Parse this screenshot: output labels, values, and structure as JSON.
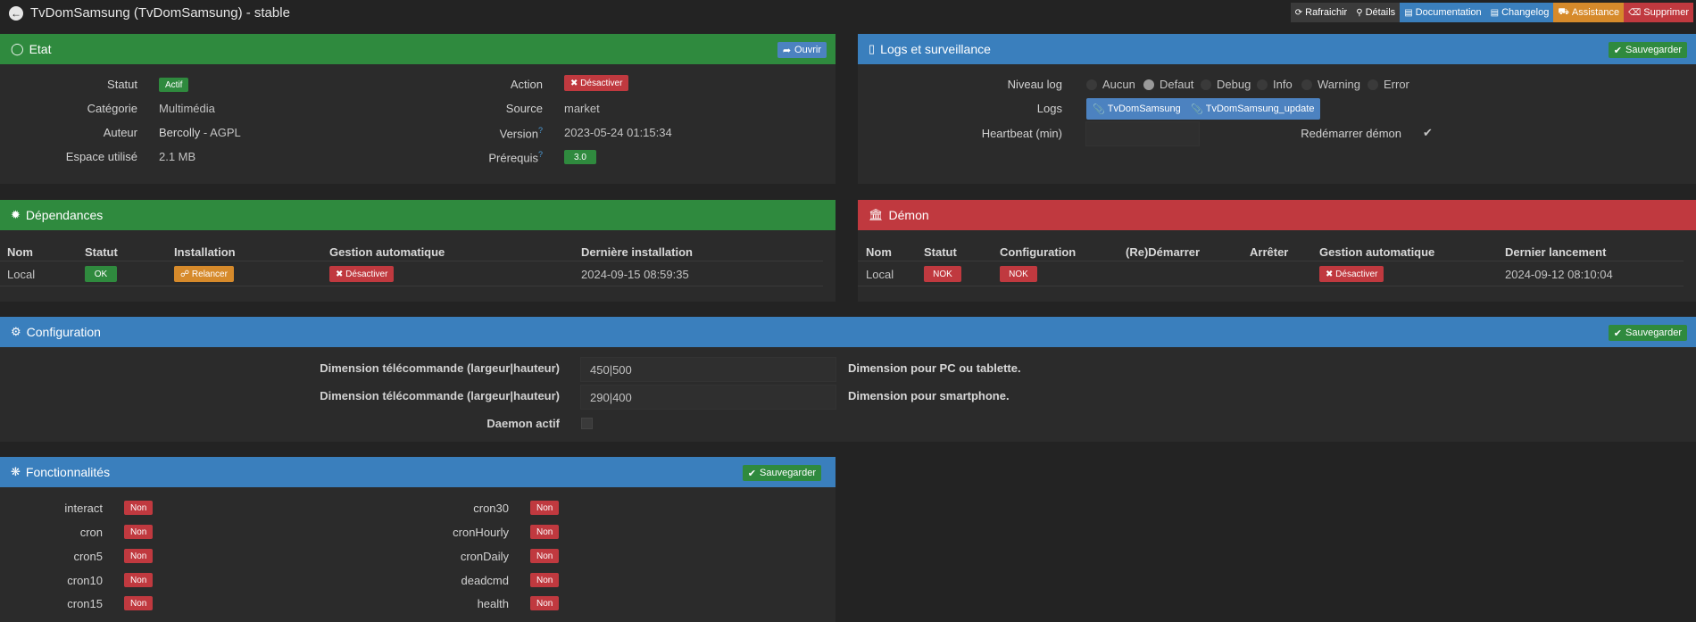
{
  "header": {
    "title": "TvDomSamsung (TvDomSamsung) - stable",
    "actions": [
      {
        "icon": "refresh-icon",
        "label": "Rafraichir",
        "color": "#3b3b3b"
      },
      {
        "icon": "search-icon",
        "label": "Détails",
        "color": "#3b3b3b"
      },
      {
        "icon": "book-icon",
        "label": "Documentation",
        "color": "#3a7fbd"
      },
      {
        "icon": "file-icon",
        "label": "Changelog",
        "color": "#3a7fbd"
      },
      {
        "icon": "ambulance-icon",
        "label": "Assistance",
        "color": "#d68a2b"
      },
      {
        "icon": "trash-icon",
        "label": "Supprimer",
        "color": "#c0393f"
      }
    ]
  },
  "etat": {
    "title": "Etat",
    "open_button": "Ouvrir",
    "statut_label": "Statut",
    "statut_value": "Actif",
    "categorie_label": "Catégorie",
    "categorie_value": "Multimédia",
    "auteur_label": "Auteur",
    "auteur_value": "Bercolly",
    "auteur_license": " - AGPL",
    "espace_label": "Espace utilisé",
    "espace_value": "2.1 MB",
    "action_label": "Action",
    "action_value": "Désactiver",
    "source_label": "Source",
    "source_value": "market",
    "version_label": "Version",
    "version_value": "2023-05-24 01:15:34",
    "prerequis_label": "Prérequis",
    "prerequis_value": "3.0"
  },
  "logs": {
    "title": "Logs et surveillance",
    "save_button": "Sauvegarder",
    "niveau_label": "Niveau log",
    "levels": [
      "Aucun",
      "Defaut",
      "Debug",
      "Info",
      "Warning",
      "Error"
    ],
    "selected_level": "Defaut",
    "logs_label": "Logs",
    "log_buttons": [
      "TvDomSamsung",
      "TvDomSamsung_update"
    ],
    "heartbeat_label": "Heartbeat (min)",
    "heartbeat_value": "",
    "restart_label": "Redémarrer démon",
    "restart_checked": true
  },
  "dependances": {
    "title": "Dépendances",
    "columns": [
      "Nom",
      "Statut",
      "Installation",
      "Gestion automatique",
      "Dernière installation"
    ],
    "row": {
      "nom": "Local",
      "statut": "OK",
      "installation": "Relancer",
      "gestion": "Désactiver",
      "derniere": "2024-09-15 08:59:35"
    }
  },
  "demon": {
    "title": "Démon",
    "columns": [
      "Nom",
      "Statut",
      "Configuration",
      "(Re)Démarrer",
      "Arrêter",
      "Gestion automatique",
      "Dernier lancement"
    ],
    "row": {
      "nom": "Local",
      "statut": "NOK",
      "configuration": "NOK",
      "gestion": "Désactiver",
      "dernier": "2024-09-12 08:10:04"
    }
  },
  "configuration": {
    "title": "Configuration",
    "save_button": "Sauvegarder",
    "fields": [
      {
        "label": "Dimension télécommande (largeur|hauteur)",
        "value": "450|500",
        "hint": "Dimension pour PC ou tablette."
      },
      {
        "label": "Dimension télécommande (largeur|hauteur)",
        "value": "290|400",
        "hint": "Dimension pour smartphone."
      }
    ],
    "daemon_label": "Daemon actif",
    "daemon_checked": false
  },
  "fonctionnalites": {
    "title": "Fonctionnalités",
    "save_button": "Sauvegarder",
    "left": [
      {
        "name": "interact",
        "value": "Non"
      },
      {
        "name": "cron",
        "value": "Non"
      },
      {
        "name": "cron5",
        "value": "Non"
      },
      {
        "name": "cron10",
        "value": "Non"
      },
      {
        "name": "cron15",
        "value": "Non"
      }
    ],
    "right": [
      {
        "name": "cron30",
        "value": "Non"
      },
      {
        "name": "cronHourly",
        "value": "Non"
      },
      {
        "name": "cronDaily",
        "value": "Non"
      },
      {
        "name": "deadcmd",
        "value": "Non"
      },
      {
        "name": "health",
        "value": "Non"
      }
    ]
  }
}
